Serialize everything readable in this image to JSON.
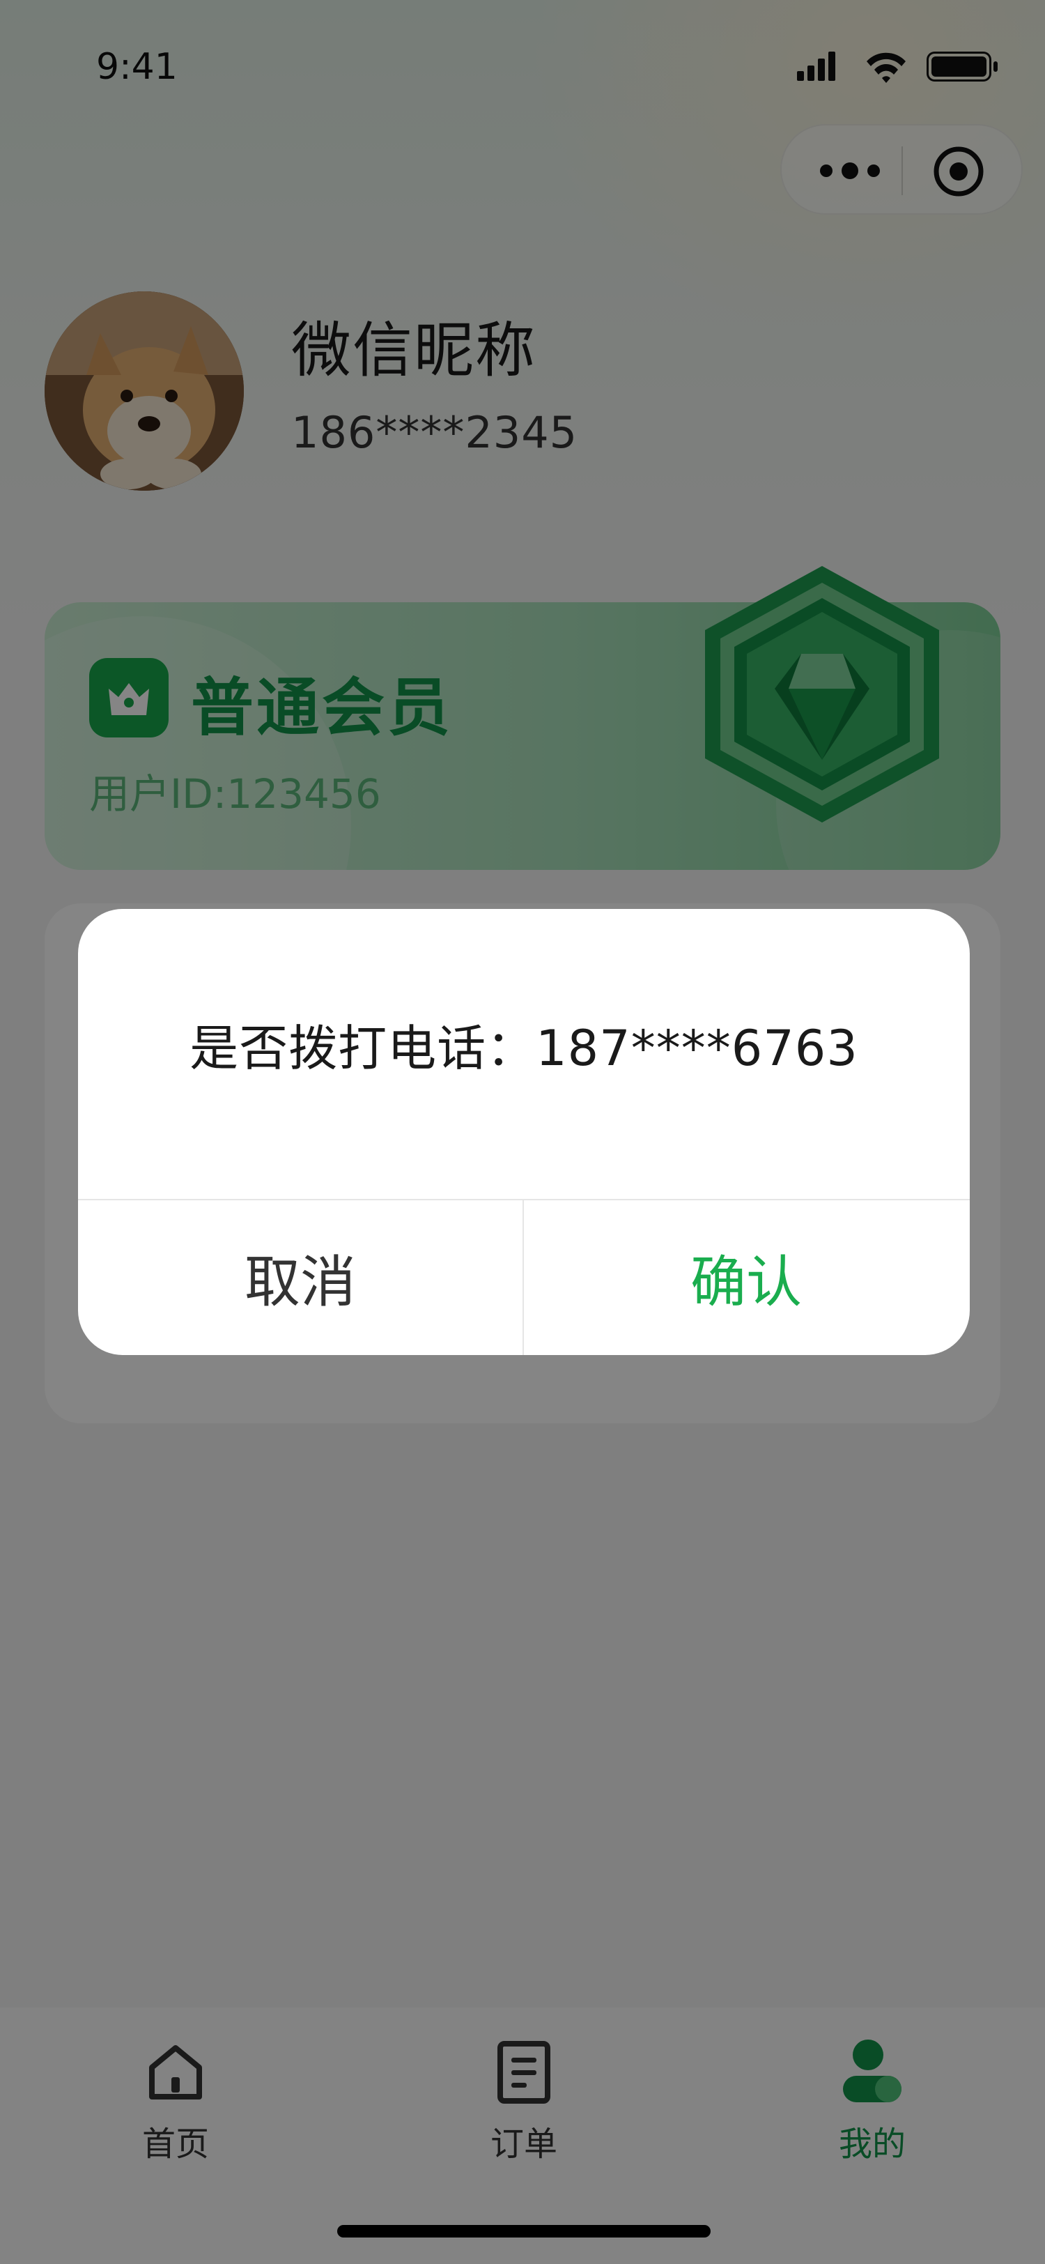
{
  "status_bar": {
    "time": "9:41"
  },
  "profile": {
    "nickname": "微信昵称",
    "phone": "186****2345"
  },
  "member_card": {
    "level": "普通会员",
    "user_id": "用户ID:123456"
  },
  "dialog": {
    "message": "是否拨打电话：187****6763",
    "cancel_label": "取消",
    "confirm_label": "确认"
  },
  "tabbar": {
    "items": [
      {
        "label": "首页",
        "icon": "home-icon"
      },
      {
        "label": "订单",
        "icon": "order-icon"
      },
      {
        "label": "我的",
        "icon": "user-icon",
        "active": true
      }
    ]
  },
  "colors": {
    "brand": "#13934a",
    "confirm": "#1aad4e"
  }
}
